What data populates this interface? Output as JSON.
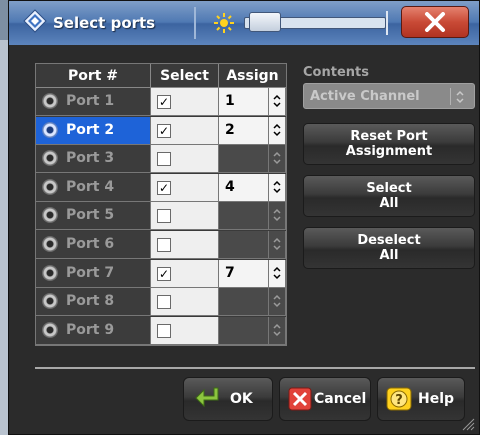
{
  "window": {
    "title": "Select ports",
    "close_label": "X"
  },
  "table": {
    "headers": [
      "Port #",
      "Select",
      "Assign"
    ],
    "rows": [
      {
        "port": "Port 1",
        "selected": true,
        "assign": "1",
        "highlighted": false
      },
      {
        "port": "Port 2",
        "selected": true,
        "assign": "2",
        "highlighted": true
      },
      {
        "port": "Port 3",
        "selected": false,
        "assign": "",
        "highlighted": false
      },
      {
        "port": "Port 4",
        "selected": true,
        "assign": "4",
        "highlighted": false
      },
      {
        "port": "Port 5",
        "selected": false,
        "assign": "",
        "highlighted": false
      },
      {
        "port": "Port 6",
        "selected": false,
        "assign": "",
        "highlighted": false
      },
      {
        "port": "Port 7",
        "selected": true,
        "assign": "7",
        "highlighted": false
      },
      {
        "port": "Port 8",
        "selected": false,
        "assign": "",
        "highlighted": false
      },
      {
        "port": "Port 9",
        "selected": false,
        "assign": "",
        "highlighted": false
      }
    ]
  },
  "contents": {
    "label": "Contents",
    "value": "Active Channel"
  },
  "buttons": {
    "reset_line1": "Reset Port",
    "reset_line2": "Assignment",
    "select_line1": "Select",
    "select_line2": "All",
    "deselect_line1": "Deselect",
    "deselect_line2": "All",
    "ok": "OK",
    "cancel": "Cancel",
    "help": "Help"
  },
  "colors": {
    "title_bar": "#4f79b3",
    "close_button": "#c94a36",
    "selected_row": "#1e63d8",
    "dialog_background": "#2b2b2b"
  },
  "icons": {
    "title": "diamond-app-icon",
    "brightness": "sun-icon",
    "ok": "green-arrow-icon",
    "cancel": "red-x-icon",
    "help": "question-icon",
    "port": "port-connector-icon"
  }
}
